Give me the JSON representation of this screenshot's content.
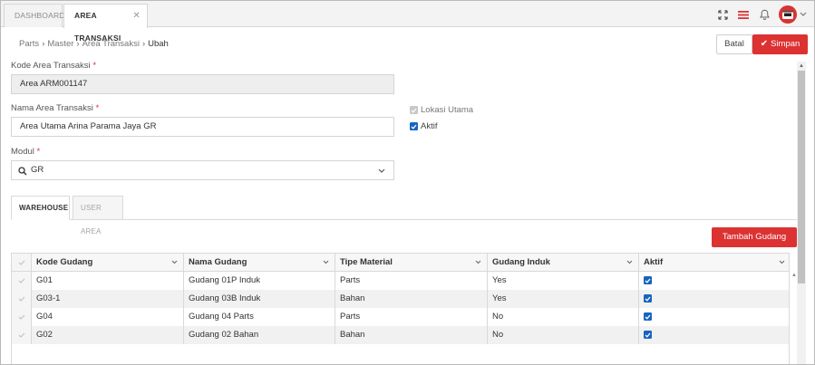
{
  "tabs": {
    "dashboard": "DASHBOARD",
    "active": "AREA TRANSAKSI",
    "close": "✕"
  },
  "breadcrumb": [
    "Parts",
    "Master",
    "Area Transaksi",
    "Ubah"
  ],
  "actions": {
    "batal": "Batal",
    "simpan": "Simpan"
  },
  "form": {
    "kode_label": "Kode Area Transaksi",
    "kode_value": "Area ARM001147",
    "nama_label": "Nama Area Transaksi",
    "nama_value": "Area Utama Arina Parama Jaya GR",
    "modul_label": "Modul",
    "modul_value": "GR",
    "required_mark": "*",
    "lokasi_utama": "Lokasi Utama",
    "aktif": "Aktif"
  },
  "inner_tabs": {
    "warehouse": "WAREHOUSE",
    "user_area": "USER AREA"
  },
  "tambah_gudang": "Tambah Gudang",
  "grid": {
    "columns": [
      "Kode Gudang",
      "Nama Gudang",
      "Tipe Material",
      "Gudang Induk",
      "Aktif"
    ],
    "rows": [
      {
        "kode": "G01",
        "nama": "Gudang 01P Induk",
        "tipe": "Parts",
        "induk": "Yes",
        "aktif": true
      },
      {
        "kode": "G03-1",
        "nama": "Gudang 03B Induk",
        "tipe": "Bahan",
        "induk": "Yes",
        "aktif": true
      },
      {
        "kode": "G04",
        "nama": "Gudang 04 Parts",
        "tipe": "Parts",
        "induk": "No",
        "aktif": true
      },
      {
        "kode": "G02",
        "nama": "Gudang 02 Bahan",
        "tipe": "Bahan",
        "induk": "No",
        "aktif": true
      }
    ]
  },
  "colors": {
    "primary_red": "#dc3232",
    "checkbox_blue": "#1565c0"
  }
}
